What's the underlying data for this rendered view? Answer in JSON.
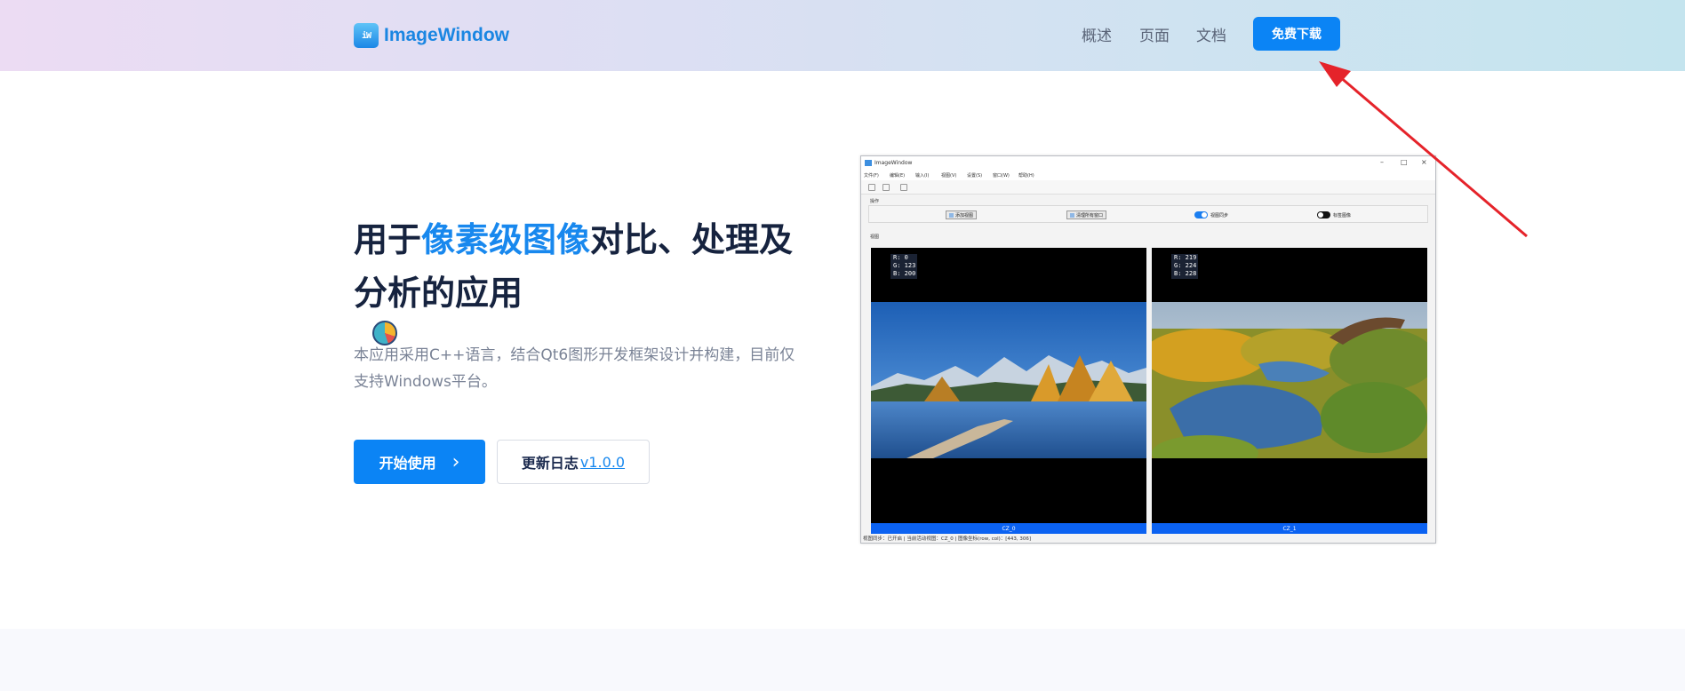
{
  "brand": {
    "logo_glyph": "iW",
    "name": "ImageWindow"
  },
  "nav": {
    "items": [
      "概述",
      "页面",
      "文档"
    ],
    "download_label": "免费下载"
  },
  "hero": {
    "title_part1": "用于",
    "title_accent": "像素级图像",
    "title_part2": "对比、处理及分析的应用",
    "description": "本应用采用C++语言，结合Qt6图形开发框架设计并构建，目前仅支持Windows平台。",
    "start_label": "开始使用",
    "changelog_label": "更新日志",
    "version": "v1.0.0"
  },
  "app": {
    "window_title": "ImageWindow",
    "menu": [
      "文件(F)",
      "编辑(E)",
      "输入(I)",
      "视图(V)",
      "设置(S)",
      "窗口(W)",
      "帮助(H)"
    ],
    "ops_label": "操作",
    "add_button": "添加视图",
    "clear_button": "清理所有窗口",
    "sync_toggle": "视图同步",
    "mark_toggle": "标签图像",
    "views_label": "视图",
    "left": {
      "caption": "CZ_0",
      "r": "R: 0",
      "g": "G: 123",
      "b": "B: 200"
    },
    "right": {
      "caption": "CZ_1",
      "r": "R: 219",
      "g": "G: 224",
      "b": "B: 228"
    },
    "status": "视图同步：已开启 | 当前活动视图：CZ_0 | 图像坐标(row, col)：[443, 306]"
  },
  "colors": {
    "accent": "#0b84f5",
    "title": "#16233f",
    "arrow": "#e5232a"
  }
}
